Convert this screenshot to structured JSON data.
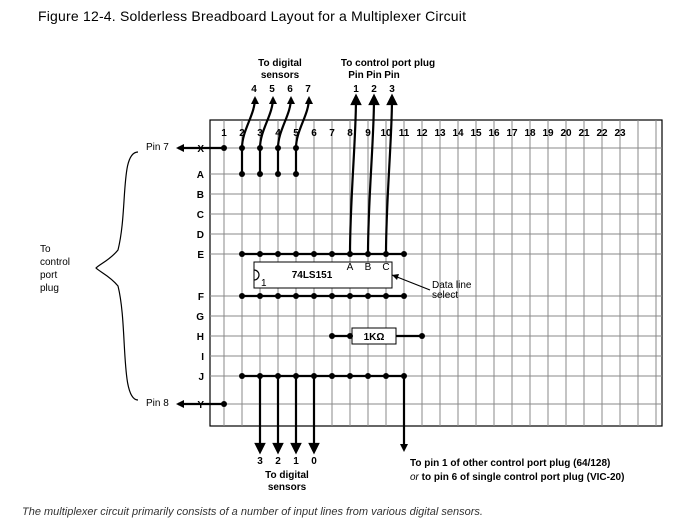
{
  "title": "Figure 12-4. Solderless Breadboard Layout for a Multiplexer Circuit",
  "caption": "The multiplexer circuit primarily consists of a number of input lines from various digital sensors.",
  "top_labels": {
    "digital_line1": "To digital",
    "digital_line2": "sensors",
    "control_line1": "To control port plug",
    "pins": [
      "Pin",
      "Pin",
      "Pin"
    ],
    "upper_pin_nums": [
      "4",
      "5",
      "6",
      "7"
    ],
    "upper_ctrl_nums": [
      "1",
      "2",
      "3"
    ]
  },
  "row_labels": [
    "X",
    "A",
    "B",
    "C",
    "D",
    "E",
    "F",
    "G",
    "H",
    "I",
    "J",
    "Y"
  ],
  "col_labels": [
    "1",
    "2",
    "3",
    "4",
    "5",
    "6",
    "7",
    "8",
    "9",
    "10",
    "11",
    "12",
    "13",
    "14",
    "15",
    "16",
    "17",
    "18",
    "19",
    "20",
    "21",
    "22",
    "23"
  ],
  "left": {
    "brace_text1": "To",
    "brace_text2": "control",
    "brace_text3": "port",
    "brace_text4": "plug",
    "pin7": "Pin 7",
    "pin8": "Pin 8"
  },
  "chip": {
    "name": "74LS151",
    "pin1": "1",
    "a": "A",
    "b": "B",
    "c": "C",
    "annot_line1": "Data line",
    "annot_line2": "select"
  },
  "resistor": "1KΩ",
  "bottom": {
    "nums": [
      "3",
      "2",
      "1",
      "0"
    ],
    "dig1": "To digital",
    "dig2": "sensors",
    "right1": "To pin 1 of other control port plug (64/128)",
    "right2_a": "or ",
    "right2_b": "to pin 6 of single control port plug (VIC-20)"
  },
  "chart_data": {
    "type": "table",
    "title": "Breadboard bus-strip layout",
    "rows": [
      "X",
      "A",
      "B",
      "C",
      "D",
      "E",
      "F",
      "G",
      "H",
      "I",
      "J",
      "Y"
    ],
    "columns": [
      1,
      2,
      3,
      4,
      5,
      6,
      7,
      8,
      9,
      10,
      11,
      12,
      13,
      14,
      15,
      16,
      17,
      18,
      19,
      20,
      21,
      22,
      23
    ],
    "ic": {
      "part": "74LS151",
      "span_rows": [
        "E",
        "F"
      ],
      "span_cols": [
        3,
        10
      ],
      "labeled_pins": {
        "A": [
          "E",
          8
        ],
        "B": [
          "E",
          9
        ],
        "C": [
          "E",
          10
        ],
        "1": [
          "F",
          3
        ]
      }
    },
    "resistor": {
      "value": "1KΩ",
      "row": "H",
      "cols": [
        8,
        10
      ]
    },
    "connections": [
      {
        "desc": "Pin 7 → X1",
        "from": "external Pin7",
        "to": [
          "X",
          1
        ]
      },
      {
        "desc": "X2 digital sensor 4",
        "from": "top-4",
        "to": [
          "X",
          2
        ]
      },
      {
        "desc": "X3 digital sensor 5",
        "from": "top-5",
        "to": [
          "X",
          3
        ]
      },
      {
        "desc": "X4 digital sensor 6",
        "from": "top-6",
        "to": [
          "X",
          4
        ]
      },
      {
        "desc": "X5 digital sensor 7",
        "from": "top-7",
        "to": [
          "X",
          5
        ]
      },
      {
        "desc": "X2→A2",
        "from": [
          "X",
          2
        ],
        "to": [
          "A",
          2
        ]
      },
      {
        "desc": "X3→A3",
        "from": [
          "X",
          3
        ],
        "to": [
          "A",
          3
        ]
      },
      {
        "desc": "X4→A4",
        "from": [
          "X",
          4
        ],
        "to": [
          "A",
          4
        ]
      },
      {
        "desc": "X5→A5",
        "from": [
          "X",
          5
        ],
        "to": [
          "A",
          5
        ]
      },
      {
        "desc": "ctrl Pin1 → E8",
        "from": "top-ctrl-1",
        "to": [
          "E",
          8
        ]
      },
      {
        "desc": "ctrl Pin2 → E9",
        "from": "top-ctrl-2",
        "to": [
          "E",
          9
        ]
      },
      {
        "desc": "ctrl Pin3 → E10",
        "from": "top-ctrl-3",
        "to": [
          "E",
          10
        ]
      },
      {
        "desc": "H7→H8",
        "from": [
          "H",
          7
        ],
        "to": [
          "H",
          8
        ]
      },
      {
        "desc": "H10→H11",
        "from": [
          "H",
          10
        ],
        "to": [
          "H",
          11
        ]
      },
      {
        "desc": "Pin 8 → Y1",
        "from": "external Pin8",
        "to": [
          "Y",
          1
        ]
      },
      {
        "desc": "J3 → bottom sensor 3",
        "from": [
          "J",
          3
        ],
        "to": "bot-3"
      },
      {
        "desc": "J4 → bottom sensor 2",
        "from": [
          "J",
          4
        ],
        "to": "bot-2"
      },
      {
        "desc": "J5 → bottom sensor 1",
        "from": [
          "J",
          5
        ],
        "to": "bot-1"
      },
      {
        "desc": "J6 → bottom sensor 0",
        "from": [
          "J",
          6
        ],
        "to": "bot-0"
      },
      {
        "desc": "J11 → other control port",
        "from": [
          "J",
          11
        ],
        "to": "external-ctrl"
      },
      {
        "desc": "E row bus above IC",
        "from": [
          "E",
          2
        ],
        "to": [
          "E",
          11
        ]
      },
      {
        "desc": "F row bus below IC",
        "from": [
          "F",
          2
        ],
        "to": [
          "F",
          11
        ]
      },
      {
        "desc": "J row bus",
        "from": [
          "J",
          2
        ],
        "to": [
          "J",
          11
        ]
      }
    ]
  }
}
